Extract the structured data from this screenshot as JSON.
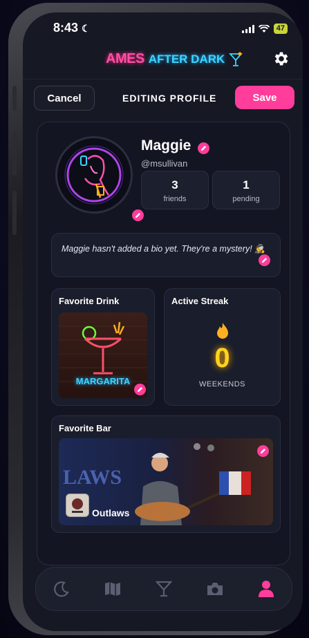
{
  "status_bar": {
    "time": "8:43",
    "battery": "47"
  },
  "app": {
    "logo_part1": "AMES",
    "logo_part2": "AFTER DARK"
  },
  "edit_bar": {
    "cancel_label": "Cancel",
    "title": "EDITING PROFILE",
    "save_label": "Save"
  },
  "profile": {
    "name": "Maggie",
    "handle": "@msullivan",
    "stats": [
      {
        "value": "3",
        "label": "friends"
      },
      {
        "value": "1",
        "label": "pending"
      }
    ],
    "bio": "Maggie hasn't added a bio yet. They're a mystery! 🕵️"
  },
  "favorite_drink": {
    "title": "Favorite Drink",
    "image_text": "MARGARITA"
  },
  "active_streak": {
    "title": "Active Streak",
    "value": "0",
    "unit_label": "WEEKENDS"
  },
  "favorite_bar": {
    "title": "Favorite Bar",
    "name": "Outlaws",
    "image_text": "LAWS"
  },
  "tab_bar": {
    "items": [
      {
        "icon": "moon-icon",
        "active": false
      },
      {
        "icon": "map-icon",
        "active": false
      },
      {
        "icon": "cocktail-icon",
        "active": false
      },
      {
        "icon": "camera-icon",
        "active": false
      },
      {
        "icon": "user-icon",
        "active": true
      }
    ]
  },
  "colors": {
    "accent": "#ff3d9a",
    "streak": "#ffd21f",
    "background": "#161824"
  }
}
